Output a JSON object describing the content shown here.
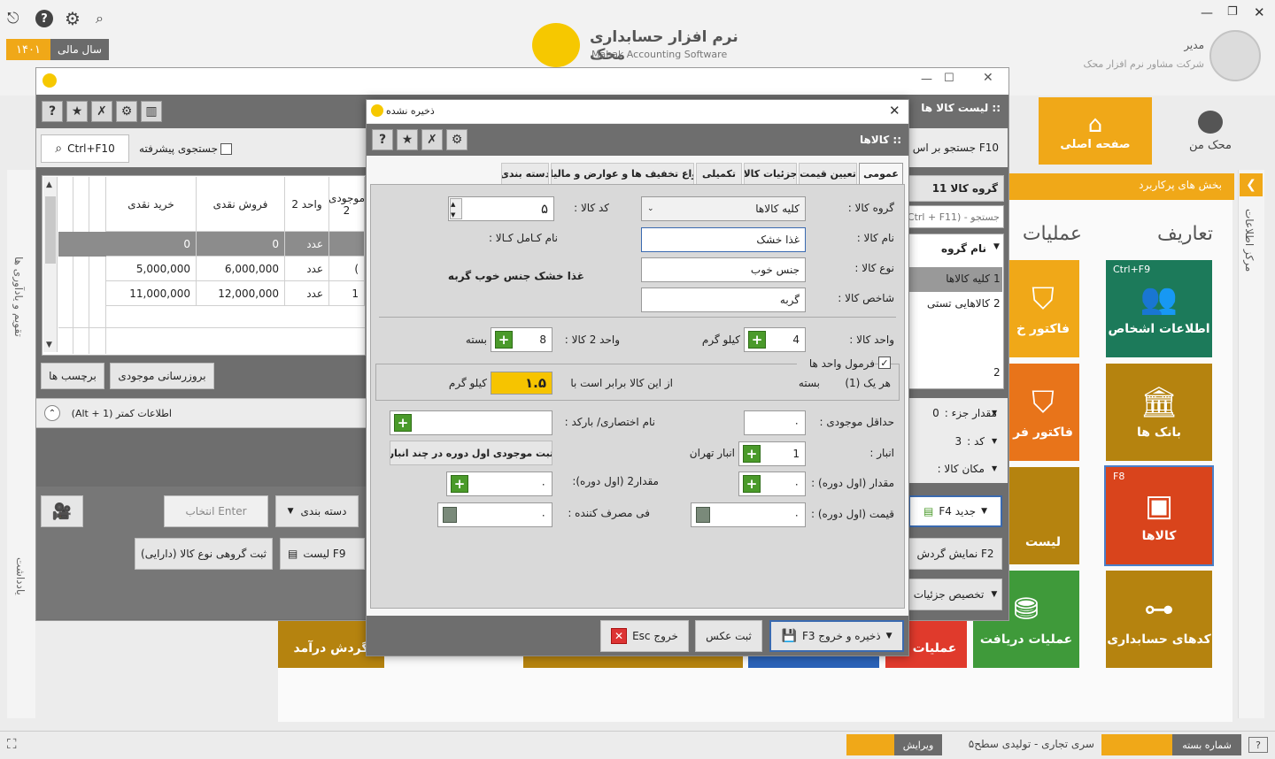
{
  "top": {
    "app_name_fa": "نرم افزار حسابداری محک",
    "app_name_en": "Mahak Accounting Software",
    "fiscal_year_label": "سال مالی",
    "fiscal_year_value": "۱۴۰۱",
    "user_name": "مدیر",
    "company_name": "شرکت مشاور نرم افزار محک"
  },
  "nav": {
    "home_label": "صفحه اصلی",
    "mahak_label": "محک من",
    "frequent_label": "بخش های پرکاربرد",
    "info_center": "مرکز اطلاعات",
    "calendar": "تقویم و یادآوری ها",
    "notes": "یادداشت",
    "definitions": "تعاریف",
    "operations": "عملیات"
  },
  "tiles": {
    "persons_shortcut": "Ctrl+F9",
    "persons": "اطلاعات اشخاص",
    "banks": "بانک ها",
    "goods_shortcut": "F8",
    "goods": "کالاها",
    "acc_codes": "کدهای حسابداری",
    "invoice1": "فاکتور خ",
    "invoice2": "فاکتور فر",
    "list": "لیست",
    "receipts": "عملیات دریافت",
    "ops2": "عملیات پ",
    "revenue": "گردش درآمد"
  },
  "list_window": {
    "title": ":: لیست کالا ها",
    "search_shortcut": "Ctrl+F10",
    "advanced_search": "جستجوی پیشرفته",
    "search_f10": "F10 جستجو بر اس",
    "group_header": "گروه کالا",
    "group_count": "11",
    "search_ctrl": "جستجو - (Ctrl + F11)",
    "group_col": "نام گروه",
    "groups": [
      {
        "no": "1",
        "name": "کلیه کالاها"
      },
      {
        "no": "2",
        "name": "کالاهایی تستی"
      }
    ],
    "group_total": "2",
    "columns": [
      "خرید نقدی",
      "فروش نقدی",
      "واحد 2",
      "موجودی 2"
    ],
    "rows": [
      {
        "buy": "0",
        "sell": "0",
        "unit": "عدد",
        "stock": ""
      },
      {
        "buy": "5,000,000",
        "sell": "6,000,000",
        "unit": "عدد",
        "stock": "("
      },
      {
        "buy": "11,000,000",
        "sell": "12,000,000",
        "unit": "عدد",
        "stock": "1"
      }
    ],
    "update_stock": "بروزرسانی موجودی",
    "labels_btn": "برچسب ها",
    "more_info": "اطلاعات کمتر (Alt + 1)",
    "part_qty_label": "مقدار جزء :",
    "part_qty_value": "0",
    "code_label": "کد :",
    "code_value": "3",
    "location_label": "مکان کالا :",
    "new_btn": "جدید F4",
    "show_flow": "نمایش گردش F2",
    "allocate": "تخصیص جزئیات",
    "enter_select": "انتخاب Enter",
    "categorize": "دسته بندی",
    "list_f9": "لیست F9",
    "group_register": "ثبت گروهی نوع کالا (دارایی)"
  },
  "dialog": {
    "title": "ذخیره نشده",
    "header": ":: کالاها",
    "tabs": [
      "عمومی",
      "تعیین قیمت",
      "جزئیات کالا",
      "تکمیلی",
      "انواع تخفیف ها و عوارض و مالیات",
      "دسته بندی"
    ],
    "group_label": "گروه کالا :",
    "group_value": "کلیه کالاها",
    "code_label": "کد کالا :",
    "code_value": "۵",
    "name_label": "نام کالا :",
    "name_value": "غذا خشک",
    "full_name_label": "نام کـامل کـالا :",
    "type_label": "نوع کالا :",
    "type_value": "جنس خوب",
    "full_name_value": "غذا خشک جنس خوب گربه",
    "index_label": "شاخص کالا :",
    "index_value": "گربه",
    "unit_label": "واحد کالا :",
    "unit_value": "4",
    "unit_name": "کیلو گرم",
    "unit2_label": "واحد 2 کالا :",
    "unit2_value": "8",
    "unit2_name": "بسته",
    "formula_label": "فرمول واحد ها",
    "each_label": "هر یک (1)",
    "each_unit": "بسته",
    "equals_label": "از این کالا برابر است با",
    "ratio_value": "۱.۵",
    "ratio_unit": "کیلو گرم",
    "min_stock_label": "حداقل موجودی :",
    "min_stock_value": "۰",
    "barcode_label": "نام اختصاری/ بارکد :",
    "warehouse_label": "انبار :",
    "warehouse_value": "1",
    "warehouse_name": "انبار تهران",
    "multi_wh_btn": "ثبت موجودی اول دوره در چند انبار",
    "qty_label": "مقدار (اول دوره) :",
    "qty_value": "۰",
    "qty2_label": "مقدار2 (اول دوره):",
    "qty2_value": "۰",
    "price_label": "قیمت (اول دوره) :",
    "price_value": "۰",
    "consumer_label": "فی مصرف کننده :",
    "consumer_value": "۰",
    "save_exit": "ذخیره و خروج F3",
    "photo_btn": "ثبت عکس",
    "exit_btn": "خروج Esc"
  },
  "status": {
    "package_label": "شماره بسته",
    "series": "سری تجاری - تولیدی سطح۵",
    "version_label": "ویرایش"
  }
}
